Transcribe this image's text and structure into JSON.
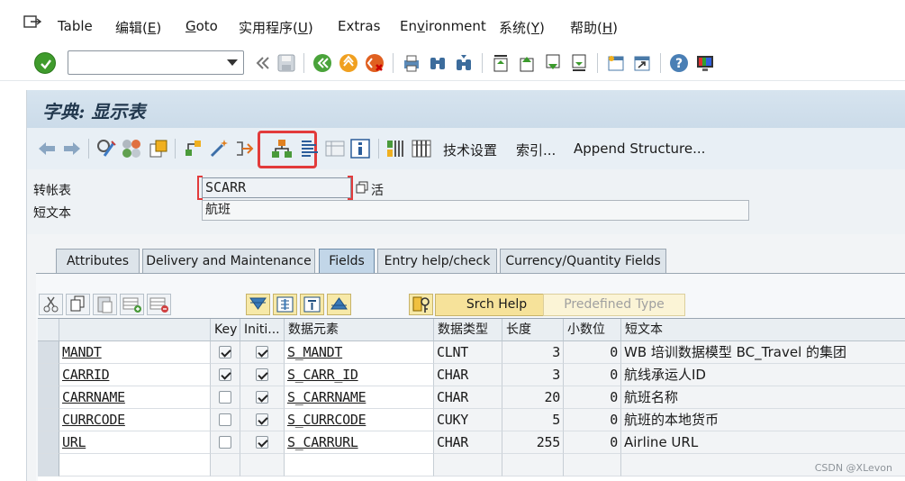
{
  "menu": {
    "items": [
      "Table",
      "编辑(E)",
      "Goto",
      "实用程序(U)",
      "Extras",
      "Environment",
      "系统(Y)",
      "帮助(H)"
    ],
    "underline": [
      "",
      "E",
      "G",
      "U",
      "",
      "v",
      "Y",
      "H"
    ]
  },
  "stdbar": {
    "command_value": "",
    "icons": [
      "enter-icon",
      "back-icon",
      "save-icon",
      "back-green-icon",
      "exit-icon",
      "cancel-icon",
      "print-icon",
      "find-icon",
      "find-next-icon",
      "first-page-icon",
      "prev-page-icon",
      "next-page-icon",
      "last-page-icon",
      "new-session-icon",
      "shortcut-icon",
      "help-icon",
      "customize-layout-icon"
    ]
  },
  "page": {
    "title": "字典: 显示表",
    "toolbar": {
      "tech_settings": "技术设置",
      "index": "索引...",
      "append_structure": "Append Structure..."
    }
  },
  "form": {
    "table_label": "转帐表",
    "table_value": "SCARR",
    "status_label": "活",
    "short_text_label": "短文本",
    "short_text_value": "航班"
  },
  "tabs": [
    {
      "label": "Attributes",
      "active": false
    },
    {
      "label": "Delivery and Maintenance",
      "active": false
    },
    {
      "label": "Fields",
      "active": true
    },
    {
      "label": "Entry help/check",
      "active": false
    },
    {
      "label": "Currency/Quantity Fields",
      "active": false
    }
  ],
  "table_toolbar": {
    "srch_help": "Srch Help",
    "predefined_type": "Predefined Type"
  },
  "grid": {
    "columns": [
      "Key",
      "Initi...",
      "数据元素",
      "数据类型",
      "长度",
      "小数位",
      "短文本"
    ],
    "rows": [
      {
        "field": "MANDT",
        "key": true,
        "initial": true,
        "element": "S_MANDT",
        "type": "CLNT",
        "length": "3",
        "decimals": "0",
        "text": "WB 培训数据模型 BC_Travel 的集团"
      },
      {
        "field": "CARRID",
        "key": true,
        "initial": true,
        "element": "S_CARR_ID",
        "type": "CHAR",
        "length": "3",
        "decimals": "0",
        "text": "航线承运人ID"
      },
      {
        "field": "CARRNAME",
        "key": false,
        "initial": true,
        "element": "S_CARRNAME",
        "type": "CHAR",
        "length": "20",
        "decimals": "0",
        "text": "航班名称"
      },
      {
        "field": "CURRCODE",
        "key": false,
        "initial": true,
        "element": "S_CURRCODE",
        "type": "CUKY",
        "length": "5",
        "decimals": "0",
        "text": "航班的本地货币"
      },
      {
        "field": "URL",
        "key": false,
        "initial": true,
        "element": "S_CARRURL",
        "type": "CHAR",
        "length": "255",
        "decimals": "0",
        "text": "Airline URL"
      }
    ]
  },
  "watermark": "CSDN @XLevon",
  "colors": {
    "title_bg": "#cbdbe9",
    "highlight": "#e23b3b",
    "active_tab": "#c2d6e8",
    "srch_help_bg": "#f6e29a"
  }
}
